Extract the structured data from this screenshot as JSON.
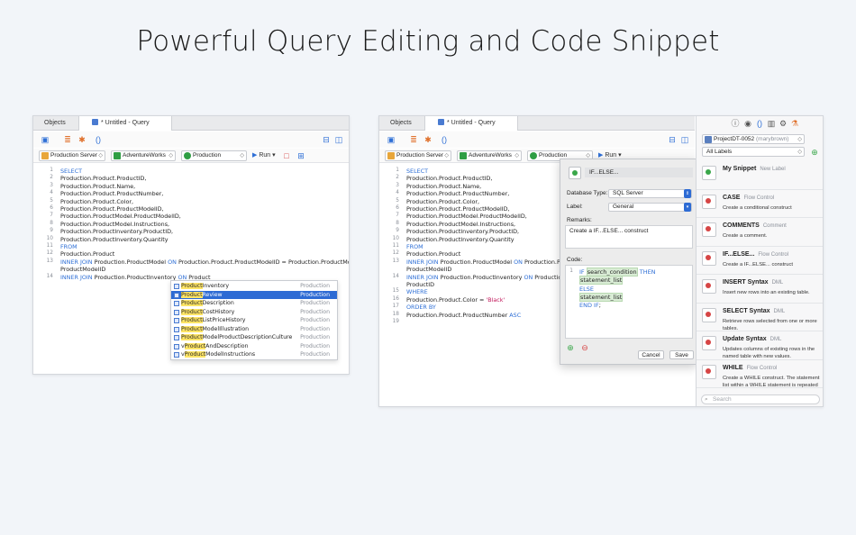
{
  "headline": "Powerful Query Editing and Code Snippet",
  "left_window": {
    "tabs": {
      "objects": "Objects",
      "query": "* Untitled - Query"
    },
    "toolbar": {
      "server": "Production Server",
      "database": "AdventureWorks",
      "schema": "Production",
      "run": "Run"
    },
    "code_lines": [
      {
        "n": "1",
        "parts": [
          {
            "t": "SELECT",
            "k": true
          }
        ]
      },
      {
        "n": "2",
        "parts": [
          {
            "t": "Production.Product.ProductID,"
          }
        ]
      },
      {
        "n": "3",
        "parts": [
          {
            "t": "Production.Product.Name,"
          }
        ]
      },
      {
        "n": "4",
        "parts": [
          {
            "t": "Production.Product.ProductNumber,"
          }
        ]
      },
      {
        "n": "5",
        "parts": [
          {
            "t": "Production.Product.Color,"
          }
        ]
      },
      {
        "n": "6",
        "parts": [
          {
            "t": "Production.Product.ProductModelID,"
          }
        ]
      },
      {
        "n": "7",
        "parts": [
          {
            "t": "Production.ProductModel.ProductModelID,"
          }
        ]
      },
      {
        "n": "8",
        "parts": [
          {
            "t": "Production.ProductModel.Instructions,"
          }
        ]
      },
      {
        "n": "9",
        "parts": [
          {
            "t": "Production.ProductInventory.ProductID,"
          }
        ]
      },
      {
        "n": "10",
        "parts": [
          {
            "t": "Production.ProductInventory.Quantity"
          }
        ]
      },
      {
        "n": "11",
        "parts": [
          {
            "t": "FROM",
            "k": true
          }
        ]
      },
      {
        "n": "12",
        "parts": [
          {
            "t": "Production.Product"
          }
        ]
      },
      {
        "n": "13",
        "parts": [
          {
            "t": "INNER JOIN",
            "k": true
          },
          {
            "t": " Production.ProductModel "
          },
          {
            "t": "ON",
            "k": true
          },
          {
            "t": " Production.Product.ProductModelID = Production.ProductModel."
          }
        ]
      },
      {
        "n": "",
        "parts": [
          {
            "t": "ProductModelID"
          }
        ]
      },
      {
        "n": "14",
        "parts": [
          {
            "t": "INNER JOIN",
            "k": true
          },
          {
            "t": " Production.ProductInventory "
          },
          {
            "t": "ON",
            "k": true
          },
          {
            "t": " Product"
          }
        ]
      }
    ],
    "autocomplete": [
      {
        "pre": "",
        "hl": "Product",
        "post": "Inventory",
        "schema": "Production",
        "selected": false
      },
      {
        "pre": "",
        "hl": "Product",
        "post": "Review",
        "schema": "Production",
        "selected": true
      },
      {
        "pre": "",
        "hl": "Product",
        "post": "Description",
        "schema": "Production",
        "selected": false
      },
      {
        "pre": "",
        "hl": "Product",
        "post": "CostHistory",
        "schema": "Production",
        "selected": false
      },
      {
        "pre": "",
        "hl": "Product",
        "post": "ListPriceHistory",
        "schema": "Production",
        "selected": false
      },
      {
        "pre": "",
        "hl": "Product",
        "post": "ModelIllustration",
        "schema": "Production",
        "selected": false
      },
      {
        "pre": "",
        "hl": "Product",
        "post": "ModelProductDescriptionCulture",
        "schema": "Production",
        "selected": false
      },
      {
        "pre": "v",
        "hl": "Product",
        "post": "AndDescription",
        "schema": "Production",
        "selected": false
      },
      {
        "pre": "v",
        "hl": "Product",
        "post": "ModelInstructions",
        "schema": "Production",
        "selected": false
      }
    ]
  },
  "right_window": {
    "tabs": {
      "objects": "Objects",
      "query": "* Untitled - Query"
    },
    "toolbar": {
      "server": "Production Server",
      "database": "AdventureWorks",
      "schema": "Production",
      "run": "Run"
    },
    "code_lines": [
      {
        "n": "1",
        "parts": [
          {
            "t": "SELECT",
            "k": true
          }
        ]
      },
      {
        "n": "2",
        "parts": [
          {
            "t": "Production.Product.ProductID,"
          }
        ]
      },
      {
        "n": "3",
        "parts": [
          {
            "t": "Production.Product.Name,"
          }
        ]
      },
      {
        "n": "4",
        "parts": [
          {
            "t": "Production.Product.ProductNumber,"
          }
        ]
      },
      {
        "n": "5",
        "parts": [
          {
            "t": "Production.Product.Color,"
          }
        ]
      },
      {
        "n": "6",
        "parts": [
          {
            "t": "Production.Product.ProductModelID,"
          }
        ]
      },
      {
        "n": "7",
        "parts": [
          {
            "t": "Production.ProductModel.ProductModelID,"
          }
        ]
      },
      {
        "n": "8",
        "parts": [
          {
            "t": "Production.ProductModel.Instructions,"
          }
        ]
      },
      {
        "n": "9",
        "parts": [
          {
            "t": "Production.ProductInventory.ProductID,"
          }
        ]
      },
      {
        "n": "10",
        "parts": [
          {
            "t": "Production.ProductInventory.Quantity"
          }
        ]
      },
      {
        "n": "11",
        "parts": [
          {
            "t": "FROM",
            "k": true
          }
        ]
      },
      {
        "n": "12",
        "parts": [
          {
            "t": "Production.Product"
          }
        ]
      },
      {
        "n": "13",
        "parts": [
          {
            "t": "INNER JOIN",
            "k": true
          },
          {
            "t": " Production.ProductModel "
          },
          {
            "t": "ON",
            "k": true
          },
          {
            "t": " Production.Produ"
          }
        ]
      },
      {
        "n": "",
        "parts": [
          {
            "t": "ProductModelID"
          }
        ]
      },
      {
        "n": "14",
        "parts": [
          {
            "t": "INNER JOIN",
            "k": true
          },
          {
            "t": " Production.ProductInventory "
          },
          {
            "t": "ON",
            "k": true
          },
          {
            "t": " Productio"
          }
        ]
      },
      {
        "n": "",
        "parts": [
          {
            "t": "ProductID"
          }
        ]
      },
      {
        "n": "15",
        "parts": [
          {
            "t": "WHERE",
            "k": true
          }
        ]
      },
      {
        "n": "16",
        "parts": [
          {
            "t": "Production.Product.Color = "
          },
          {
            "t": "'Black'",
            "s": true
          }
        ]
      },
      {
        "n": "17",
        "parts": [
          {
            "t": "ORDER BY",
            "k": true
          }
        ]
      },
      {
        "n": "18",
        "parts": [
          {
            "t": "Production.Product.ProductNumber "
          },
          {
            "t": "ASC",
            "k": true
          }
        ]
      },
      {
        "n": "19",
        "parts": []
      }
    ],
    "snippet_editor": {
      "name": "IF...ELSE...",
      "db_type_label": "Database Type:",
      "db_type_value": "SQL Server",
      "label_label": "Label:",
      "label_value": "General",
      "remarks_label": "Remarks:",
      "remarks_value": "Create a IF...ELSE... construct",
      "code_label": "Code:",
      "code_lines": [
        {
          "n": "1",
          "parts": [
            {
              "t": "IF",
              "k": true
            },
            {
              "t": " "
            },
            {
              "t": "search_condition",
              "p": true
            },
            {
              "t": " "
            },
            {
              "t": "THEN",
              "k": true
            }
          ]
        },
        {
          "n": "",
          "parts": [
            {
              "t": "  "
            },
            {
              "t": "statement_list",
              "p": true
            }
          ]
        },
        {
          "n": "",
          "parts": [
            {
              "t": "ELSE",
              "k": true
            }
          ]
        },
        {
          "n": "",
          "parts": [
            {
              "t": "  "
            },
            {
              "t": "statement_list",
              "p": true
            }
          ]
        },
        {
          "n": "",
          "parts": [
            {
              "t": "END IF",
              "k": true
            },
            {
              "t": ";"
            }
          ]
        }
      ],
      "cancel": "Cancel",
      "save": "Save"
    },
    "sidebar": {
      "project": "ProjectDT-0052",
      "project_user": "(marybrown)",
      "filter": "All Labels",
      "search_placeholder": "Search",
      "items": [
        {
          "title": "My Snippet",
          "tag": "New Label",
          "desc": "",
          "green": true
        },
        {
          "title": "CASE",
          "tag": "Flow Control",
          "desc": "Create a conditional construct",
          "green": false
        },
        {
          "title": "COMMENTS",
          "tag": "Comment",
          "desc": "Create a comment.",
          "green": false
        },
        {
          "title": "IF...ELSE...",
          "tag": "Flow Control",
          "desc": "Create a IF...ELSE... construct",
          "green": false
        },
        {
          "title": "INSERT Syntax",
          "tag": "DML",
          "desc": "Insert new rows into an existing table.",
          "green": false
        },
        {
          "title": "SELECT Syntax",
          "tag": "DML",
          "desc": "Retrieve rows selected from one or more tables.",
          "green": false
        },
        {
          "title": "Update Syntax",
          "tag": "DML",
          "desc": "Updates columns of existing rows in the named table with new values.",
          "green": false
        },
        {
          "title": "WHILE",
          "tag": "Flow Control",
          "desc": "Create a WHILE construct. The statement list within a WHILE statement is repeated",
          "green": false
        }
      ]
    }
  },
  "colors": {
    "keyword": "#2e6fd6",
    "string": "#c2185b",
    "selection": "#2d6bd4",
    "highlight": "#ffe566"
  }
}
